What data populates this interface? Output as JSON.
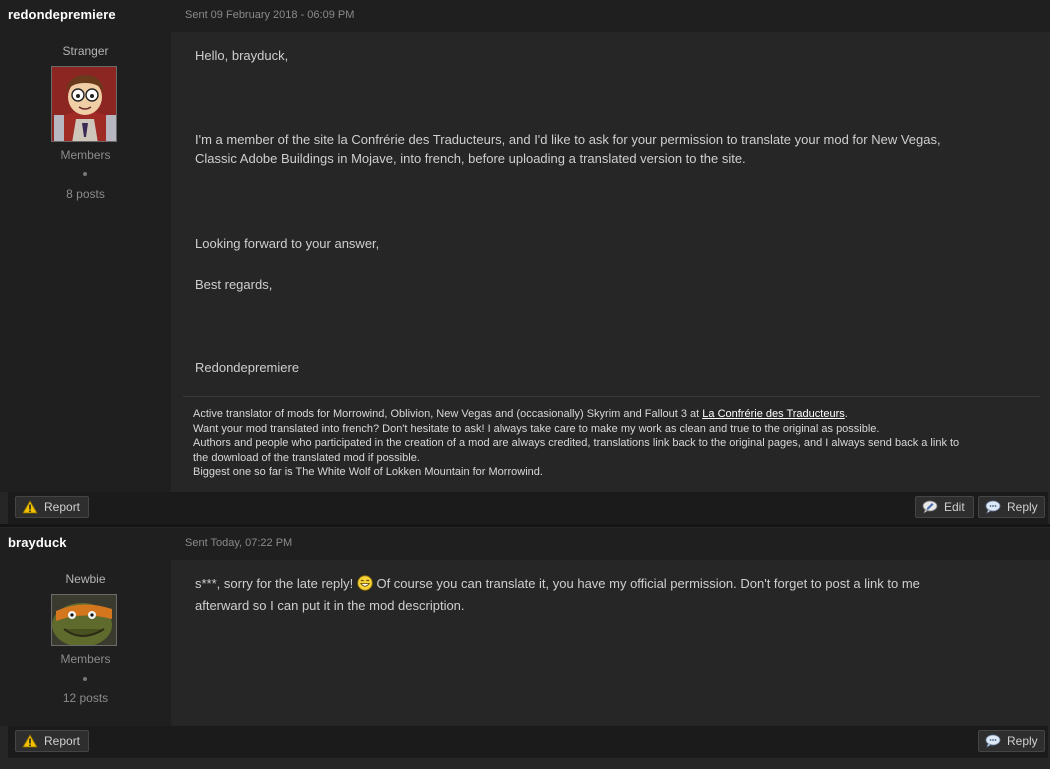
{
  "posts": [
    {
      "author": "redondepremiere",
      "date": "Sent 09 February 2018 - 06:09 PM",
      "rank": "Stranger",
      "group": "Members",
      "post_count": "8 posts",
      "message": {
        "greeting": "Hello, brayduck,",
        "paragraph1": "I'm a member of the site la Confrérie des Traducteurs, and I'd like to ask for your permission to translate your mod for New Vegas,",
        "paragraph1b": "Classic Adobe Buildings in Mojave, into french, before uploading a translated version to the site.",
        "paragraph2": "Looking forward to your answer,",
        "paragraph3": "Best regards,",
        "sign": "Redondepremiere"
      },
      "signature": {
        "line1_pre": "Active translator of mods for Morrowind, Oblivion, New Vegas and (occasionally) Skyrim and Fallout 3 at ",
        "line1_link": "La Confrérie des Traducteurs",
        "line1_post": ".",
        "line2": "Want your mod translated into french? Don't hesitate to ask! I always take care to make my work as clean and true to the original as possible.",
        "line3": "Authors and people who participated in the creation of a mod are always credited, translations link back to the original pages, and I always send back a link to",
        "line4": "the download of the translated mod if possible.",
        "line5": "Biggest one so far is The White Wolf of Lokken Mountain for Morrowind."
      },
      "buttons": {
        "report": "Report",
        "edit": "Edit",
        "reply": "Reply"
      }
    },
    {
      "author": "brayduck",
      "date": "Sent Today, 07:22 PM",
      "rank": "Newbie",
      "group": "Members",
      "post_count": "12 posts",
      "message": {
        "line1_pre": "s***, sorry for the late reply! ",
        "line1_post": " Of course you can translate it, you have my official permission. Don't forget to post a link to me",
        "line2": "afterward so I can put it in the mod description."
      },
      "buttons": {
        "report": "Report",
        "reply": "Reply"
      }
    }
  ],
  "colors": {
    "background": "#262626",
    "header": "#1f1f1f",
    "accent_warning": "#f2c200"
  }
}
